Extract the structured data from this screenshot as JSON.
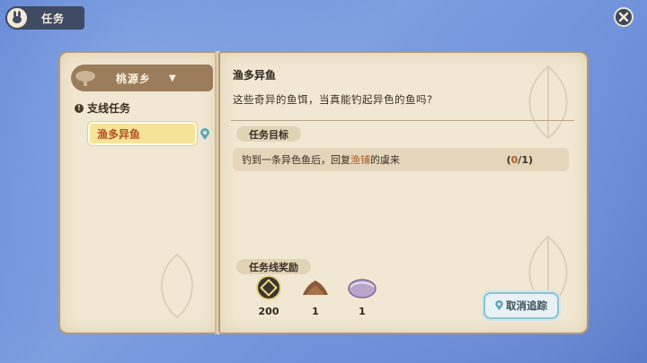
{
  "header": {
    "title": "任务"
  },
  "sidebar": {
    "region": "桃源乡",
    "category": "支线任务",
    "category_marker": "!",
    "quests": [
      {
        "label": "渔多异鱼",
        "selected": true
      }
    ]
  },
  "quest": {
    "title": "渔多异鱼",
    "description": "这些奇异的鱼饵，当真能钓起异色的鱼吗?",
    "goal_section": "任务目标",
    "goal": {
      "text_before": "钓到一条异色鱼后，回复",
      "highlight": "渔铺",
      "text_after": "的虞来",
      "current": "0",
      "total": "/1)",
      "open": "("
    },
    "rewards_section": "任务线奖励",
    "rewards": [
      {
        "icon": "coin-icon",
        "count": "200"
      },
      {
        "icon": "soil-icon",
        "count": "1"
      },
      {
        "icon": "clam-icon",
        "count": "1"
      }
    ],
    "untrack_button": "取消追踪"
  },
  "colors": {
    "accent": "#b35a29",
    "page": "#f1e8d3",
    "panel": "#e3d6ba"
  }
}
